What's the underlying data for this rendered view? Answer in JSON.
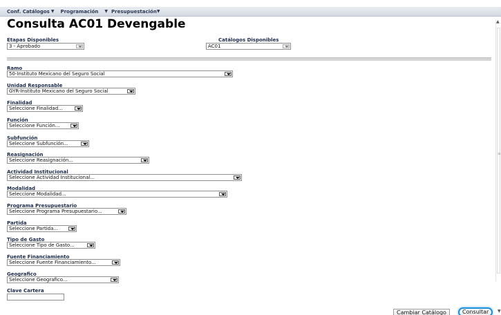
{
  "menu": [
    {
      "label": "Conf. Catálogos"
    },
    {
      "label": "Programación"
    },
    {
      "label": "Presupuestación"
    }
  ],
  "page_title": "Consulta AC01 Devengable",
  "etapas": {
    "label": "Etapas Disponibles",
    "value": "3 - Aprobado"
  },
  "catalogos": {
    "label": "Catálogos Disponibles",
    "value": "AC01"
  },
  "fields": {
    "ramo": {
      "label": "Ramo",
      "value": "50-Instituto Mexicano del Seguro Social"
    },
    "unidad": {
      "label": "Unidad Responsable",
      "value": "GYR-Instituto Mexicano del Seguro Social"
    },
    "finalidad": {
      "label": "Finalidad",
      "value": "Seleccione Finalidad..."
    },
    "funcion": {
      "label": "Función",
      "value": "Seleccione Función..."
    },
    "subfuncion": {
      "label": "Subfunción",
      "value": "Seleccione Subfunción..."
    },
    "reasignacion": {
      "label": "Reasignación",
      "value": "Seleccione Reasignación..."
    },
    "actividad": {
      "label": "Actividad Institucional",
      "value": "Seleccione Actividad Institucional..."
    },
    "modalidad": {
      "label": "Modalidad",
      "value": "Seleccione Modalidad..."
    },
    "programa": {
      "label": "Programa Presupuestario",
      "value": "Seleccione Programa Presupuestario..."
    },
    "partida": {
      "label": "Partida",
      "value": "Seleccione Partida..."
    },
    "tipo_gasto": {
      "label": "Tipo de Gasto",
      "value": "Seleccione Tipo de Gasto..."
    },
    "fuente": {
      "label": "Fuente Financiamiento",
      "value": "Seleccione Fuente Financiamiento..."
    },
    "geografico": {
      "label": "Geografico",
      "value": "Seleccione Geografico..."
    },
    "clave_cartera": {
      "label": "Clave Cartera",
      "value": ""
    }
  },
  "buttons": {
    "cambiar": "Cambiar Catálogo",
    "consultar": "Consultar"
  }
}
